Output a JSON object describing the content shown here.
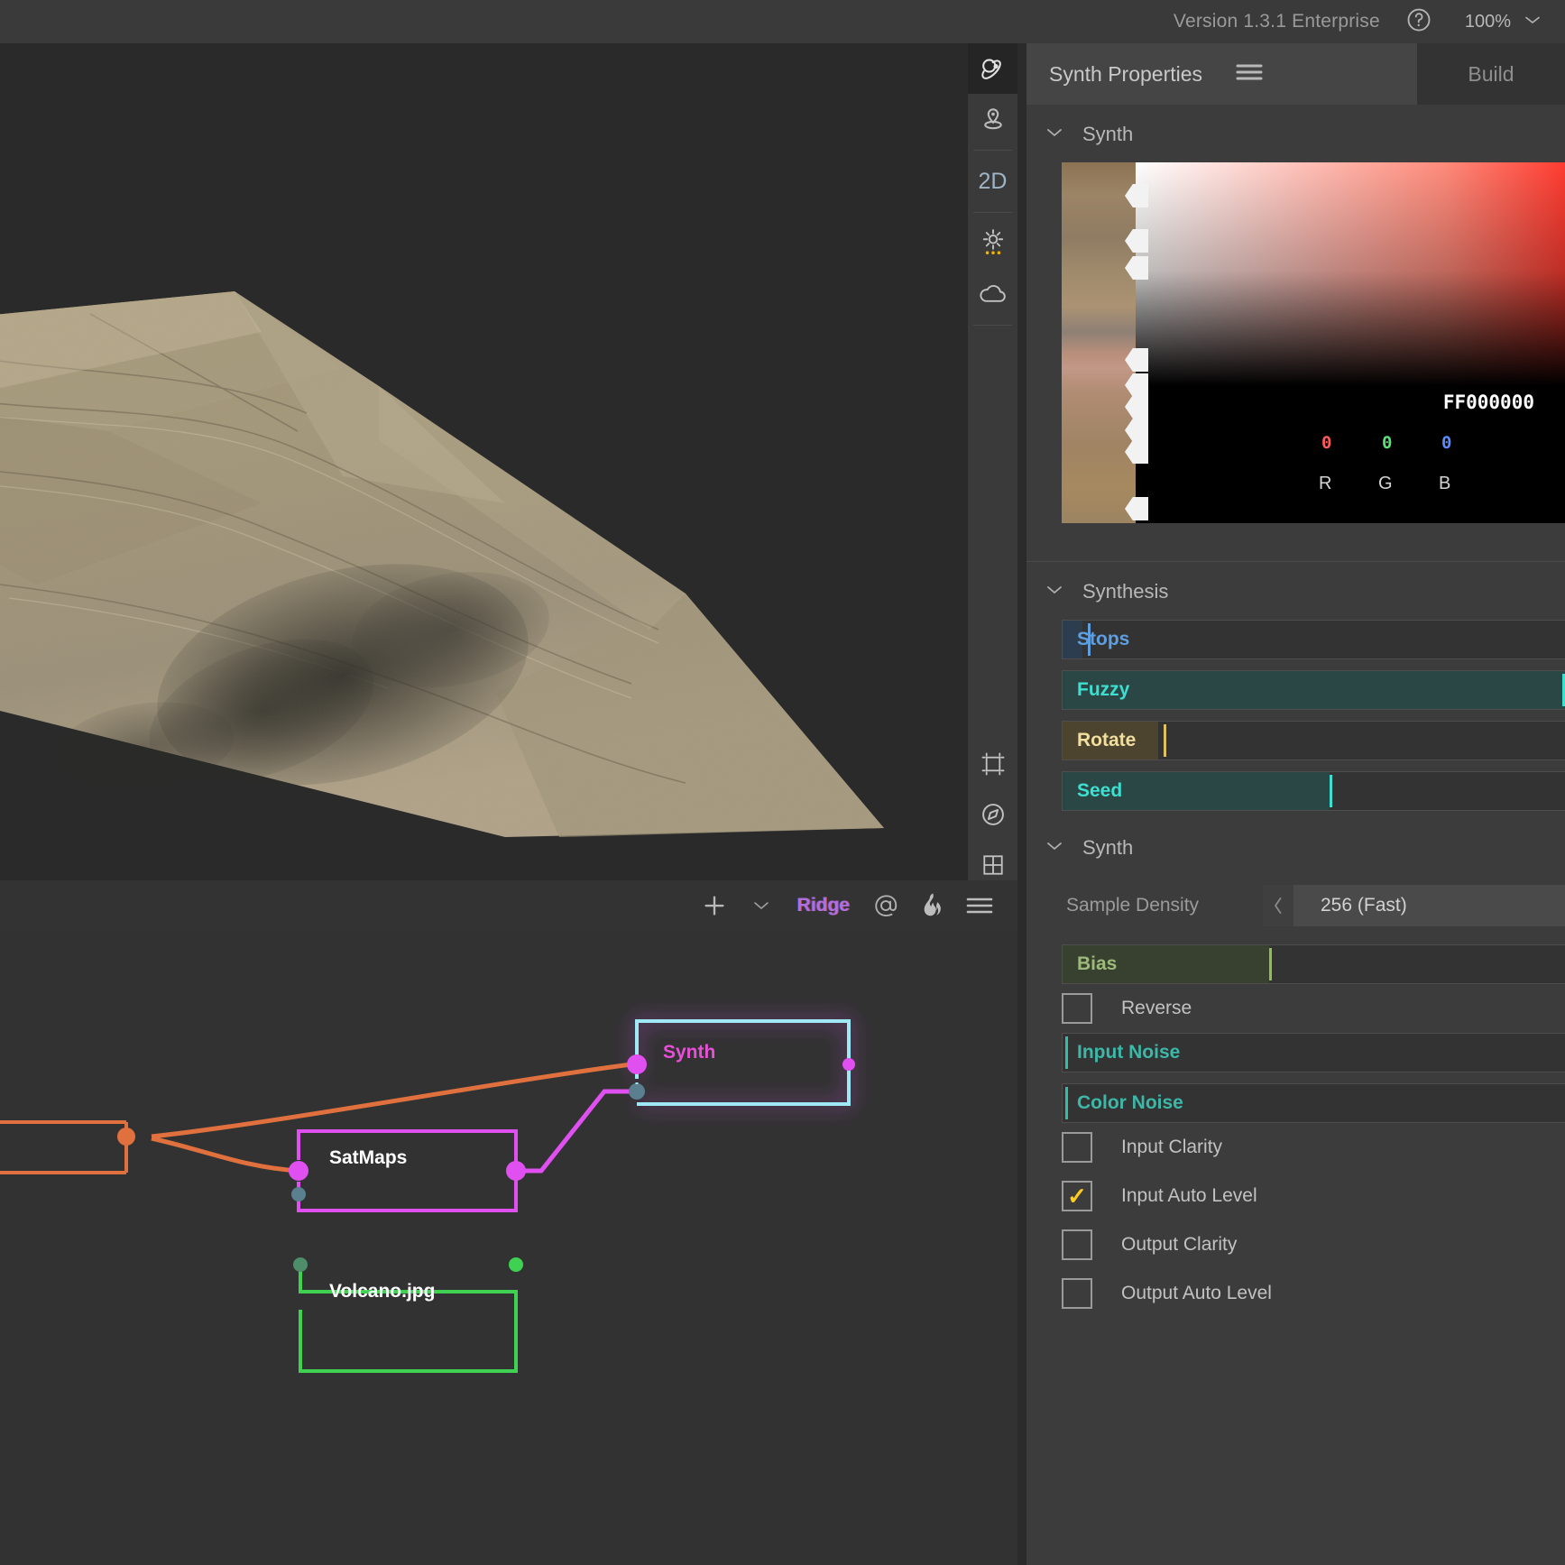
{
  "topbar": {
    "version": "Version 1.3.1 Enterprise",
    "help_icon": "help-circle-icon",
    "zoom": "100%",
    "zoom_chevron": "chevron-down-icon"
  },
  "viewport": {
    "name": "3d-terrain-preview"
  },
  "rail": {
    "items": [
      {
        "icon": "orbit-icon",
        "name": "rail-orbit",
        "selected": true
      },
      {
        "icon": "pin-icon",
        "name": "rail-marker",
        "selected": false
      },
      {
        "icon": "2d-text",
        "label": "2D",
        "name": "rail-2d",
        "selected": false
      },
      {
        "icon": "sun-icon",
        "name": "rail-lighting",
        "selected": false
      },
      {
        "icon": "cloud-icon",
        "name": "rail-sky",
        "selected": false
      },
      {
        "icon": "crop-icon",
        "name": "rail-crop",
        "selected": false
      },
      {
        "icon": "compass-icon",
        "name": "rail-compass",
        "selected": false
      },
      {
        "icon": "grid-icon",
        "name": "rail-grid",
        "selected": false
      }
    ]
  },
  "graph_toolbar": {
    "add_label": "+",
    "chevron": "chevron-down-icon",
    "preset": "Ridge",
    "at_icon": "at-icon",
    "flame_icon": "flame-icon",
    "menu_icon": "hamburger-icon"
  },
  "graph": {
    "nodes": [
      {
        "label": "",
        "name": "node-upstream",
        "color": "#e0713f"
      },
      {
        "label": "SatMaps",
        "name": "node-satmaps",
        "color": "#e050f0"
      },
      {
        "label": "Volcano.jpg",
        "name": "node-volcano",
        "color": "#3fd152"
      },
      {
        "label": "Synth",
        "name": "node-synth",
        "color": "#9fe8f5",
        "selected": true,
        "label_color": "#e84fd8"
      }
    ]
  },
  "panel": {
    "title": "Synth Properties",
    "menu_icon": "hamburger-icon",
    "build_tab": "Build",
    "sections": [
      {
        "label": "Synth",
        "name": "section-synth-gradient"
      },
      {
        "label": "Synthesis",
        "name": "section-synthesis"
      },
      {
        "label": "Synth",
        "name": "section-synth-options"
      }
    ],
    "gradient": {
      "hex": "FF000000",
      "r_value": "0",
      "g_value": "0",
      "b_value": "0",
      "r_label": "R",
      "g_label": "G",
      "b_label": "B",
      "r_color": "#ff5a5a",
      "g_color": "#5ce07a",
      "b_color": "#5a8cff",
      "stops": [
        9,
        21,
        28,
        56,
        62,
        68,
        75,
        81,
        97
      ]
    },
    "synthesis_sliders": [
      {
        "name": "slider-stops",
        "label": "Stops",
        "fill": 4,
        "cursor": 5,
        "text_color": "#5f9fe0",
        "fill_color": "#2d3d50",
        "cursor_color": "#5f9fe0"
      },
      {
        "name": "slider-fuzzy",
        "label": "Fuzzy",
        "fill": 100,
        "cursor": 100,
        "text_color": "#3de0d0",
        "fill_color": "#2a4746",
        "cursor_color": "#3de0d0"
      },
      {
        "name": "slider-rotate",
        "label": "Rotate",
        "fill": 19,
        "cursor": 20,
        "text_color": "#f2dfa0",
        "fill_color": "#4c442e",
        "cursor_color": "#e0c060"
      },
      {
        "name": "slider-seed",
        "label": "Seed",
        "fill": 53,
        "cursor": 53,
        "text_color": "#3de0d0",
        "fill_color": "#2a4746",
        "cursor_color": "#3de0d0"
      }
    ],
    "sample_density": {
      "label": "Sample Density",
      "value": "256 (Fast)",
      "prev_icon": "chevron-left-icon"
    },
    "synth_sliders": [
      {
        "name": "slider-bias",
        "label": "Bias",
        "fill": 41,
        "cursor": 41,
        "text_color": "#9dba7a",
        "fill_color": "#38402f",
        "cursor_color": "#8fbe52"
      },
      {
        "name": "slider-input-noise",
        "label": "Input Noise",
        "fill": 0,
        "cursor": 0.4,
        "text_color": "#3db8a8",
        "fill_color": "#333333",
        "cursor_color": "#2fbfa8"
      },
      {
        "name": "slider-color-noise",
        "label": "Color Noise",
        "fill": 0,
        "cursor": 0.4,
        "text_color": "#3db8a8",
        "fill_color": "#333333",
        "cursor_color": "#2fbfa8"
      }
    ],
    "checkboxes": [
      {
        "name": "checkbox-reverse",
        "label": "Reverse",
        "checked": false
      },
      {
        "name": "checkbox-input-clarity",
        "label": "Input Clarity",
        "checked": false
      },
      {
        "name": "checkbox-input-auto-level",
        "label": "Input Auto Level",
        "checked": true
      },
      {
        "name": "checkbox-output-clarity",
        "label": "Output Clarity",
        "checked": false
      },
      {
        "name": "checkbox-output-auto-level",
        "label": "Output Auto Level",
        "checked": false
      }
    ]
  }
}
